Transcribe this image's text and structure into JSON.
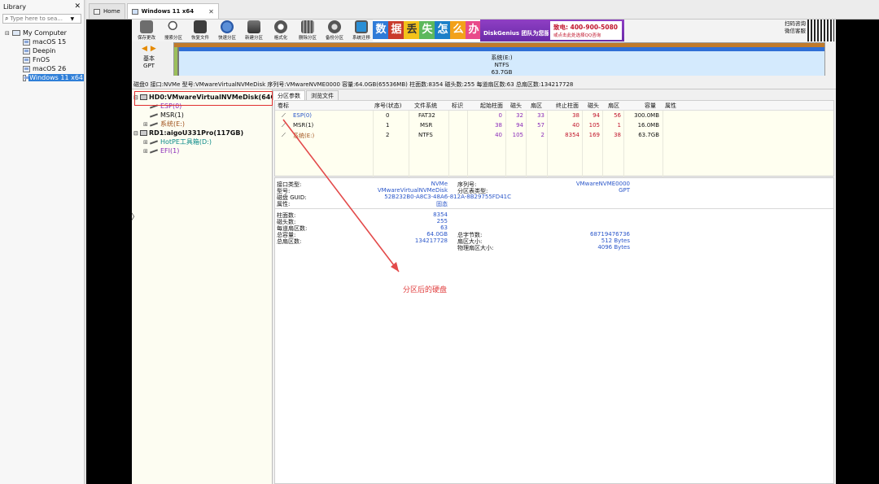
{
  "library": {
    "title": "Library",
    "search_placeholder": "Type here to sea...",
    "root": "My Computer",
    "vms": [
      "macOS 15",
      "Deepin",
      "FnOS",
      "macOS 26",
      "Windows 11 x64"
    ],
    "selected": "Windows 11 x64"
  },
  "tabs": [
    {
      "label": "Home"
    },
    {
      "label": "Windows 11 x64"
    }
  ],
  "toolbar": {
    "buttons": [
      "保存更改",
      "搜索分区",
      "恢复文件",
      "快速分区",
      "新建分区",
      "格式化",
      "删除分区",
      "备份分区",
      "系统迁移"
    ],
    "ad_chars": [
      "数",
      "据",
      "丢",
      "失",
      "怎",
      "么",
      "办"
    ],
    "ad_name": "DiskGenius 团队为您服务",
    "ad_tel": "致电: 400-900-5080",
    "ad_sub": "或点击此处选择QQ咨询",
    "qr_caption_1": "扫码咨询",
    "qr_caption_2": "微信客服"
  },
  "diskmap": {
    "basic_1": "基本",
    "basic_2": "GPT",
    "part_name": "系统(E:)",
    "part_fs": "NTFS",
    "part_size": "63.7GB"
  },
  "infoline": "磁盘0 接口:NVMe  型号:VMwareVirtualNVMeDisk  序列号:VMwareNVME0000  容量:64.0GB(65536MB)  柱面数:8354  磁头数:255  每道扇区数:63  总扇区数:134217728",
  "tree": {
    "hd0": "HD0:VMwareVirtualNVMeDisk(64GB)",
    "hd0_parts": [
      "ESP(0)",
      "MSR(1)",
      "系统(E:)"
    ],
    "rd1": "RD1:aigoU331Pro(117GB)",
    "rd1_parts": [
      "HotPE工具箱(D:)",
      "EFI(1)"
    ]
  },
  "right_tabs": [
    "分区参数",
    "浏览文件"
  ],
  "table": {
    "headers": [
      "卷标",
      "序号(状态)",
      "文件系统",
      "标识",
      "起始柱面",
      "磁头",
      "扇区",
      "终止柱面",
      "磁头",
      "扇区",
      "容量",
      "属性"
    ],
    "rows": [
      {
        "label": "ESP(0)",
        "index": "0",
        "fs": "FAT32",
        "flag": "",
        "start_cyl": "0",
        "start_head": "32",
        "start_sec": "33",
        "end_cyl": "38",
        "end_head": "94",
        "end_sec": "56",
        "size": "300.0MB",
        "attr": ""
      },
      {
        "label": "MSR(1)",
        "index": "1",
        "fs": "MSR",
        "flag": "",
        "start_cyl": "38",
        "start_head": "94",
        "start_sec": "57",
        "end_cyl": "40",
        "end_head": "105",
        "end_sec": "1",
        "size": "16.0MB",
        "attr": ""
      },
      {
        "label": "系统(E:)",
        "index": "2",
        "fs": "NTFS",
        "flag": "",
        "start_cyl": "40",
        "start_head": "105",
        "start_sec": "2",
        "end_cyl": "8354",
        "end_head": "169",
        "end_sec": "38",
        "size": "63.7GB",
        "attr": ""
      }
    ]
  },
  "details": {
    "if_type_k": "接口类型:",
    "if_type_v": "NVMe",
    "serial_k": "序列号:",
    "serial_v": "VMwareNVME0000",
    "model_k": "型号:",
    "model_v": "VMwareVirtualNVMeDisk",
    "ptype_k": "分区表类型:",
    "ptype_v": "GPT",
    "guid_k": "磁盘 GUID:",
    "guid_v": "52B232B0-A8C3-48A6-812A-8B29755FD41C",
    "attr_k": "属性:",
    "attr_v": "固态",
    "cyl_k": "柱面数:",
    "cyl_v": "8354",
    "heads_k": "磁头数:",
    "heads_v": "255",
    "spt_k": "每道扇区数:",
    "spt_v": "63",
    "cap_k": "总容量:",
    "cap_v": "64.0GB",
    "bytes_k": "总字节数:",
    "bytes_v": "68719476736",
    "tsec_k": "总扇区数:",
    "tsec_v": "134217728",
    "secsz_k": "扇区大小:",
    "secsz_v": "512 Bytes",
    "psec_k": "物理扇区大小:",
    "psec_v": "4096 Bytes"
  },
  "annotation": "分区后的硬盘",
  "colors": {
    "accent": "#2f7fd8",
    "highlight": "#e03030",
    "purple": "#8a2bb8",
    "ntfs_bar": "#2f6fd6"
  }
}
